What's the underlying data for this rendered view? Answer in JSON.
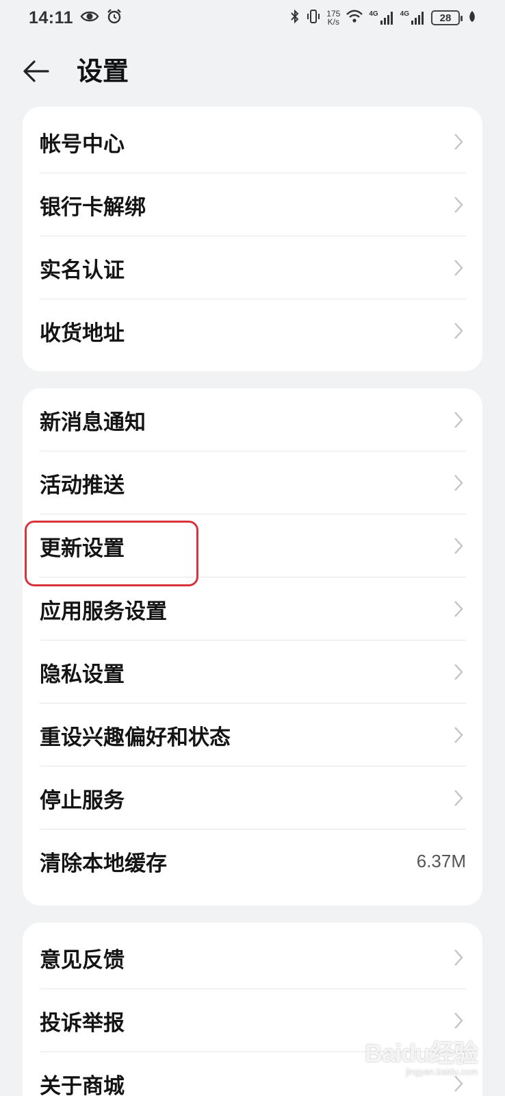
{
  "status_bar": {
    "time": "14:11",
    "speed_value": "175",
    "speed_unit": "K/s",
    "net1": "4G",
    "net2": "4G",
    "battery": "28",
    "icons": [
      "eye-icon",
      "alarm-icon",
      "bluetooth-icon",
      "vibrate-icon",
      "wifi-icon",
      "signal-icon",
      "leaf-icon"
    ]
  },
  "header": {
    "title": "设置"
  },
  "groups": [
    {
      "items": [
        {
          "label": "帐号中心"
        },
        {
          "label": "银行卡解绑"
        },
        {
          "label": "实名认证"
        },
        {
          "label": "收货地址"
        }
      ]
    },
    {
      "items": [
        {
          "label": "新消息通知"
        },
        {
          "label": "活动推送"
        },
        {
          "label": "更新设置"
        },
        {
          "label": "应用服务设置"
        },
        {
          "label": "隐私设置"
        },
        {
          "label": "重设兴趣偏好和状态"
        },
        {
          "label": "停止服务"
        },
        {
          "label": "清除本地缓存",
          "value": "6.37M"
        }
      ]
    },
    {
      "items": [
        {
          "label": "意见反馈"
        },
        {
          "label": "投诉举报"
        },
        {
          "label": "关于商城"
        }
      ]
    }
  ],
  "watermark": {
    "main": "Baidu经验",
    "sub": "jingyan.baidu.com"
  },
  "colors": {
    "background": "#f1f2f4",
    "card": "#ffffff",
    "highlight": "#d6333b"
  }
}
